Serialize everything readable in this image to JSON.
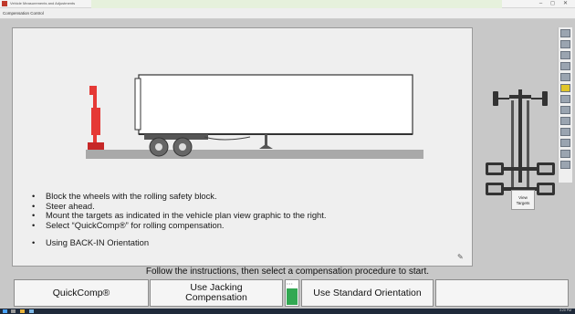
{
  "window": {
    "title": "Vehicle Measurements and Adjustments",
    "menu_title": "Compensation Control",
    "minimize": "–",
    "maximize": "◻",
    "close": "✕"
  },
  "instructions": [
    "Block the wheels with the rolling safety block.",
    "Steer ahead.",
    "Mount the targets as indicated in the vehicle plan view graphic to the right.",
    "Select “QuickComp®” for rolling compensation."
  ],
  "orientation_note": "Using BACK-IN Orientation",
  "side_panel": {
    "view_targets_line1": "View",
    "view_targets_line2": "Targets"
  },
  "message": "Follow the instructions, then select a compensation procedure to start.",
  "buttons": {
    "quickcomp": "QuickComp®",
    "jacking_line1": "Use Jacking",
    "jacking_line2": "Compensation",
    "standard_orientation": "Use Standard Orientation",
    "empty": ""
  },
  "taskbar": {
    "clock": "3:20 PM"
  },
  "colors": {
    "target_stand": "#e53935",
    "indicator_green": "#32a852",
    "taskbar": "#1f2a3a"
  }
}
